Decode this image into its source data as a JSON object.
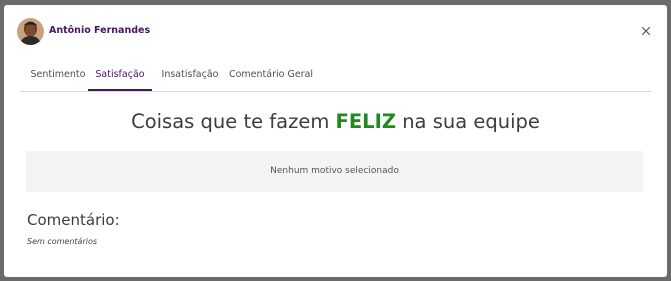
{
  "header": {
    "user_name": "Antônio Fernandes",
    "close_icon": "close-icon"
  },
  "tabs": [
    {
      "label": "Sentimento",
      "active": false
    },
    {
      "label": "Satisfação",
      "active": true
    },
    {
      "label": "Insatisfação",
      "active": false
    },
    {
      "label": "Comentário Geral",
      "active": false
    }
  ],
  "content": {
    "title_prefix": "Coisas que te fazem ",
    "title_highlight": "FELIZ",
    "title_suffix": " na sua equipe",
    "empty_message": "Nenhum motivo selecionado",
    "comment_heading": "Comentário:",
    "comment_text": "Sem comentários"
  },
  "colors": {
    "accent": "#4b1466",
    "happy": "#208a1f"
  }
}
